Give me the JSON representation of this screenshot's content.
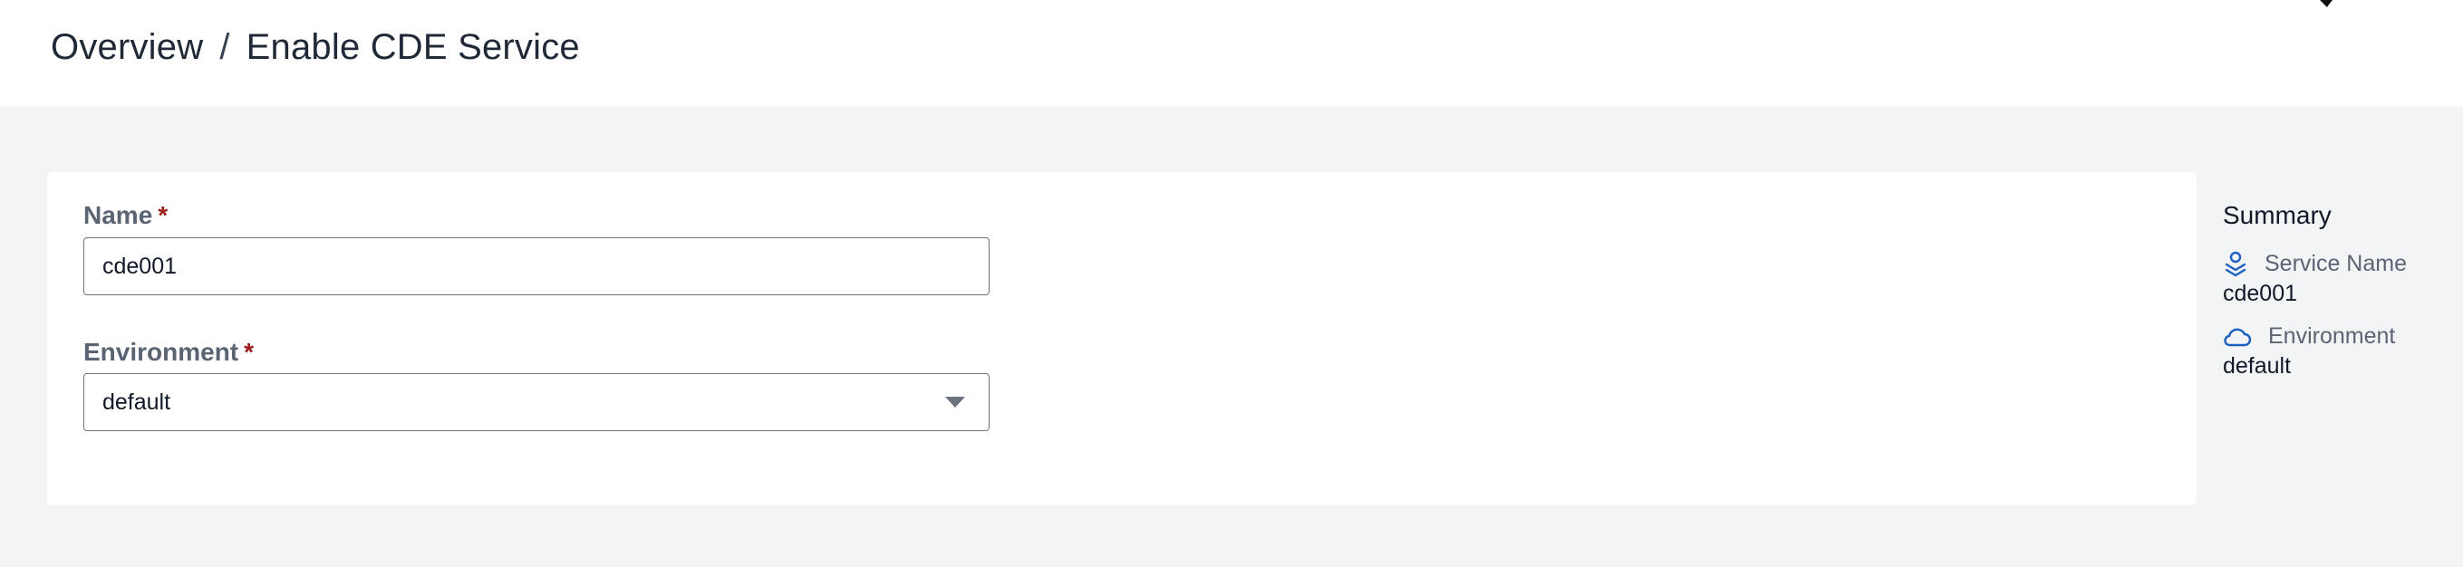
{
  "breadcrumb": {
    "root": "Overview",
    "separator": "/",
    "current": "Enable CDE Service"
  },
  "form": {
    "name": {
      "label": "Name",
      "required_mark": "*",
      "value": "cde001"
    },
    "environment": {
      "label": "Environment",
      "required_mark": "*",
      "selected": "default"
    }
  },
  "summary": {
    "title": "Summary",
    "items": [
      {
        "icon": "service-icon",
        "label": "Service Name",
        "value": "cde001"
      },
      {
        "icon": "cloud-icon",
        "label": "Environment",
        "value": "default"
      }
    ]
  },
  "colors": {
    "accent": "#1d5fbf",
    "required": "#9b1c1c",
    "page_background": "#f3f4f6"
  }
}
